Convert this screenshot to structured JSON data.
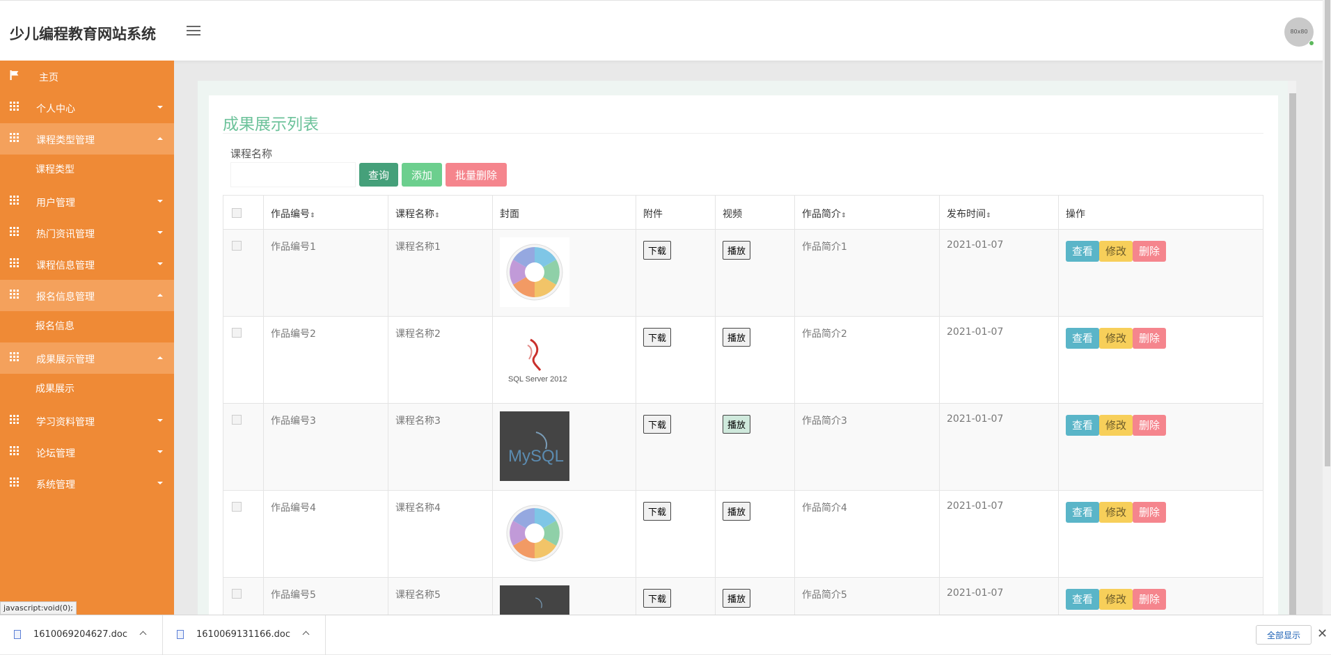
{
  "app": {
    "title": "少儿编程教育网站系统",
    "avatar_text": "80x80"
  },
  "sidebar": {
    "home": "主页",
    "items": [
      {
        "label": "个人中心"
      },
      {
        "label": "课程类型管理",
        "sub": "课程类型"
      },
      {
        "label": "用户管理"
      },
      {
        "label": "热门资讯管理"
      },
      {
        "label": "课程信息管理"
      },
      {
        "label": "报名信息管理",
        "sub": "报名信息"
      },
      {
        "label": "成果展示管理",
        "sub": "成果展示"
      },
      {
        "label": "学习资料管理"
      },
      {
        "label": "论坛管理"
      },
      {
        "label": "系统管理"
      }
    ],
    "status_url": "javascript:void(0);"
  },
  "panel": {
    "title": "成果展示列表",
    "search_label": "课程名称",
    "search_value": "",
    "btn_query": "查询",
    "btn_add": "添加",
    "btn_batch_delete": "批量删除"
  },
  "table": {
    "headers": {
      "work_no": "作品编号",
      "course_name": "课程名称",
      "cover": "封面",
      "attachment": "附件",
      "video": "视频",
      "intro": "作品简介",
      "publish_time": "发布时间",
      "actions": "操作"
    },
    "sort_icon": "⇕",
    "download_label": "下载",
    "play_label": "播放",
    "view_label": "查看",
    "edit_label": "修改",
    "delete_label": "删除",
    "rows": [
      {
        "work_no": "作品编号1",
        "course_name": "课程名称1",
        "cover": "wheel-diagram",
        "intro": "作品简介1",
        "time": "2021-01-07"
      },
      {
        "work_no": "作品编号2",
        "course_name": "课程名称2",
        "cover": "sql-server-2012",
        "cover_text": "SQL Server 2012",
        "intro": "作品简介2",
        "time": "2021-01-07"
      },
      {
        "work_no": "作品编号3",
        "course_name": "课程名称3",
        "cover": "mysql-logo",
        "cover_text": "MySQL",
        "intro": "作品简介3",
        "time": "2021-01-07"
      },
      {
        "work_no": "作品编号4",
        "course_name": "课程名称4",
        "cover": "wheel-diagram",
        "intro": "作品简介4",
        "time": "2021-01-07"
      },
      {
        "work_no": "作品编号5",
        "course_name": "课程名称5",
        "cover": "mysql-logo",
        "intro": "作品简介5",
        "time": "2021-01-07"
      }
    ]
  },
  "downloads": {
    "files": [
      "1610069204627.doc",
      "1610069131166.doc"
    ],
    "show_all": "全部显示",
    "close": "✕"
  },
  "colors": {
    "sidebar": "#ef8a36",
    "accent_green": "#6cc29a",
    "btn_view": "#5ab5c8",
    "btn_edit": "#f7cf5a",
    "btn_delete": "#f5858d"
  }
}
